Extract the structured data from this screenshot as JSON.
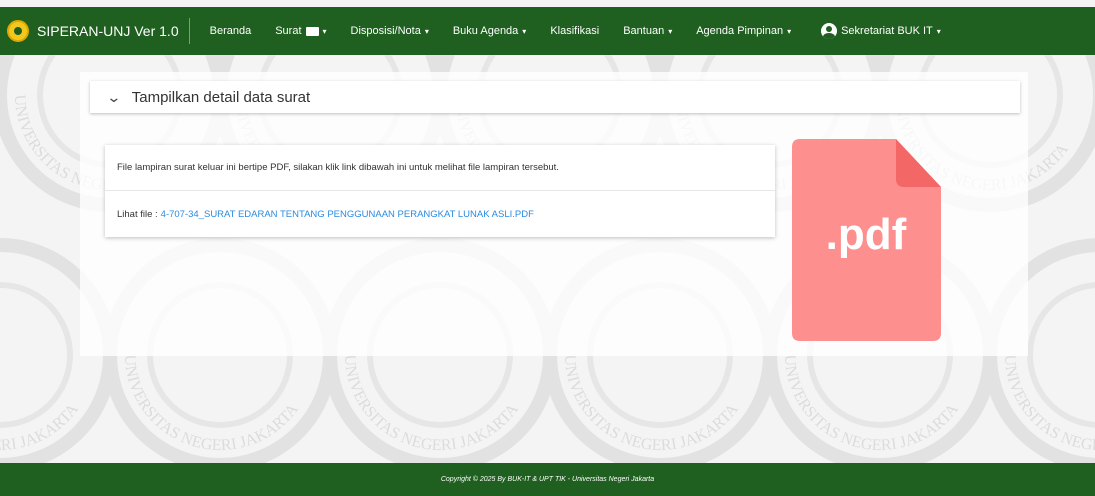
{
  "navbar": {
    "brand": "SIPERAN-UNJ Ver 1.0",
    "items": [
      {
        "label": "Beranda",
        "dropdown": false
      },
      {
        "label": "Surat",
        "dropdown": true,
        "icon": "mail-icon"
      },
      {
        "label": "Disposisi/Nota",
        "dropdown": true
      },
      {
        "label": "Buku Agenda",
        "dropdown": true
      },
      {
        "label": "Klasifikasi",
        "dropdown": false
      },
      {
        "label": "Bantuan",
        "dropdown": true
      },
      {
        "label": "Agenda Pimpinan",
        "dropdown": true
      }
    ],
    "user": "Sekretariat BUK IT",
    "caret": "▾",
    "color": "#1f5f1f"
  },
  "accordion": {
    "chevron": "⌄",
    "title": "Tampilkan detail data surat"
  },
  "attachment": {
    "info": "File lampiran surat keluar ini bertipe PDF, silakan klik link dibawah ini untuk melihat file lampiran tersebut.",
    "file_label": "Lihat file :",
    "file_name": "4-707-34_SURAT EDARAN TENTANG PENGGUNAAN PERANGKAT LUNAK ASLI.PDF",
    "file_icon_text": ".pdf",
    "link_color": "#2a8be0"
  },
  "watermark_text": "UNIVERSITAS NEGERI JAKARTA",
  "footer": {
    "text": "Copyright © 2025 By BUK-IT & UPT TIK - Universitas Negeri Jakarta"
  }
}
